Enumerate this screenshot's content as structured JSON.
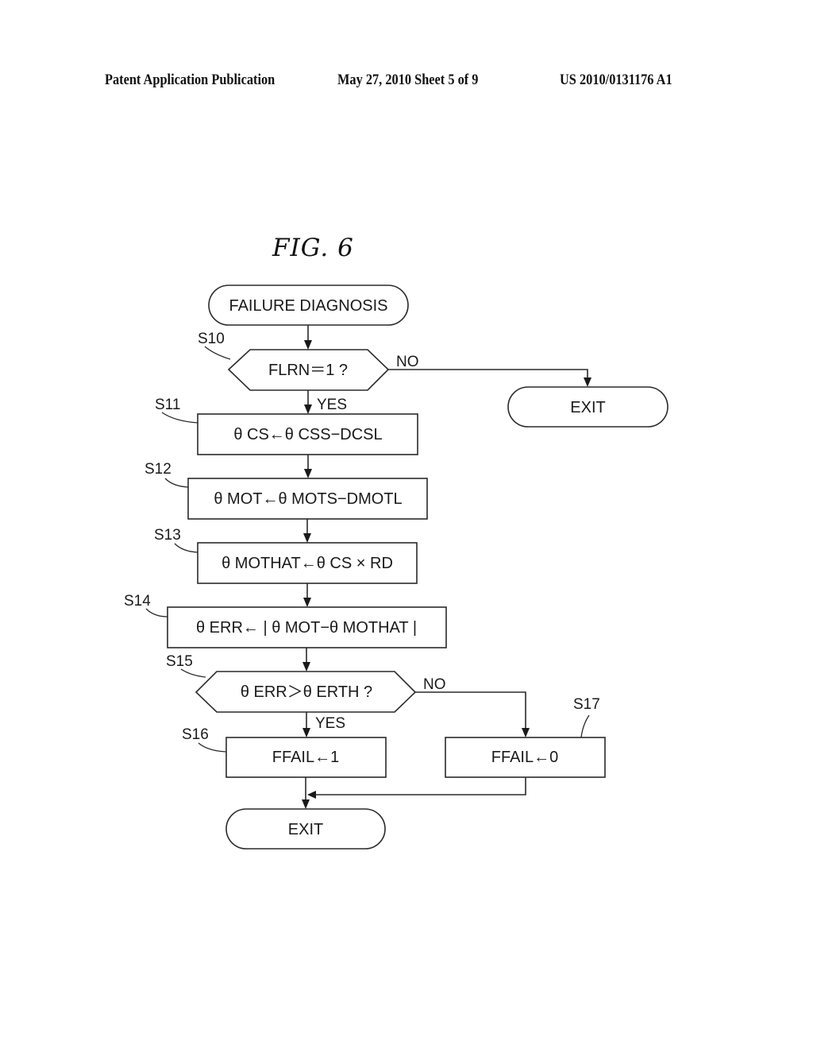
{
  "header": {
    "publication": "Patent Application Publication",
    "date_sheet": "May 27, 2010   Sheet 5 of 9",
    "number": "US 2010/0131176 A1"
  },
  "figure": {
    "title": "FIG. 6",
    "start": "FAILURE DIAGNOSIS",
    "steps": {
      "s10": {
        "label": "S10",
        "text": "FLRN＝1 ?"
      },
      "s11": {
        "label": "S11",
        "text": "θ CS←θ CSS−DCSL"
      },
      "s12": {
        "label": "S12",
        "text": "θ MOT←θ MOTS−DMOTL"
      },
      "s13": {
        "label": "S13",
        "text": "θ MOTHAT←θ CS × RD"
      },
      "s14": {
        "label": "S14",
        "text": "θ ERR← | θ MOT−θ MOTHAT |"
      },
      "s15": {
        "label": "S15",
        "text": "θ ERR＞θ ERTH ?"
      },
      "s16": {
        "label": "S16",
        "text": "FFAIL←1"
      },
      "s17": {
        "label": "S17",
        "text": "FFAIL←0"
      }
    },
    "branches": {
      "s10_yes": "YES",
      "s10_no": "NO",
      "s15_yes": "YES",
      "s15_no": "NO"
    },
    "exit_top": "EXIT",
    "exit_bottom": "EXIT"
  }
}
